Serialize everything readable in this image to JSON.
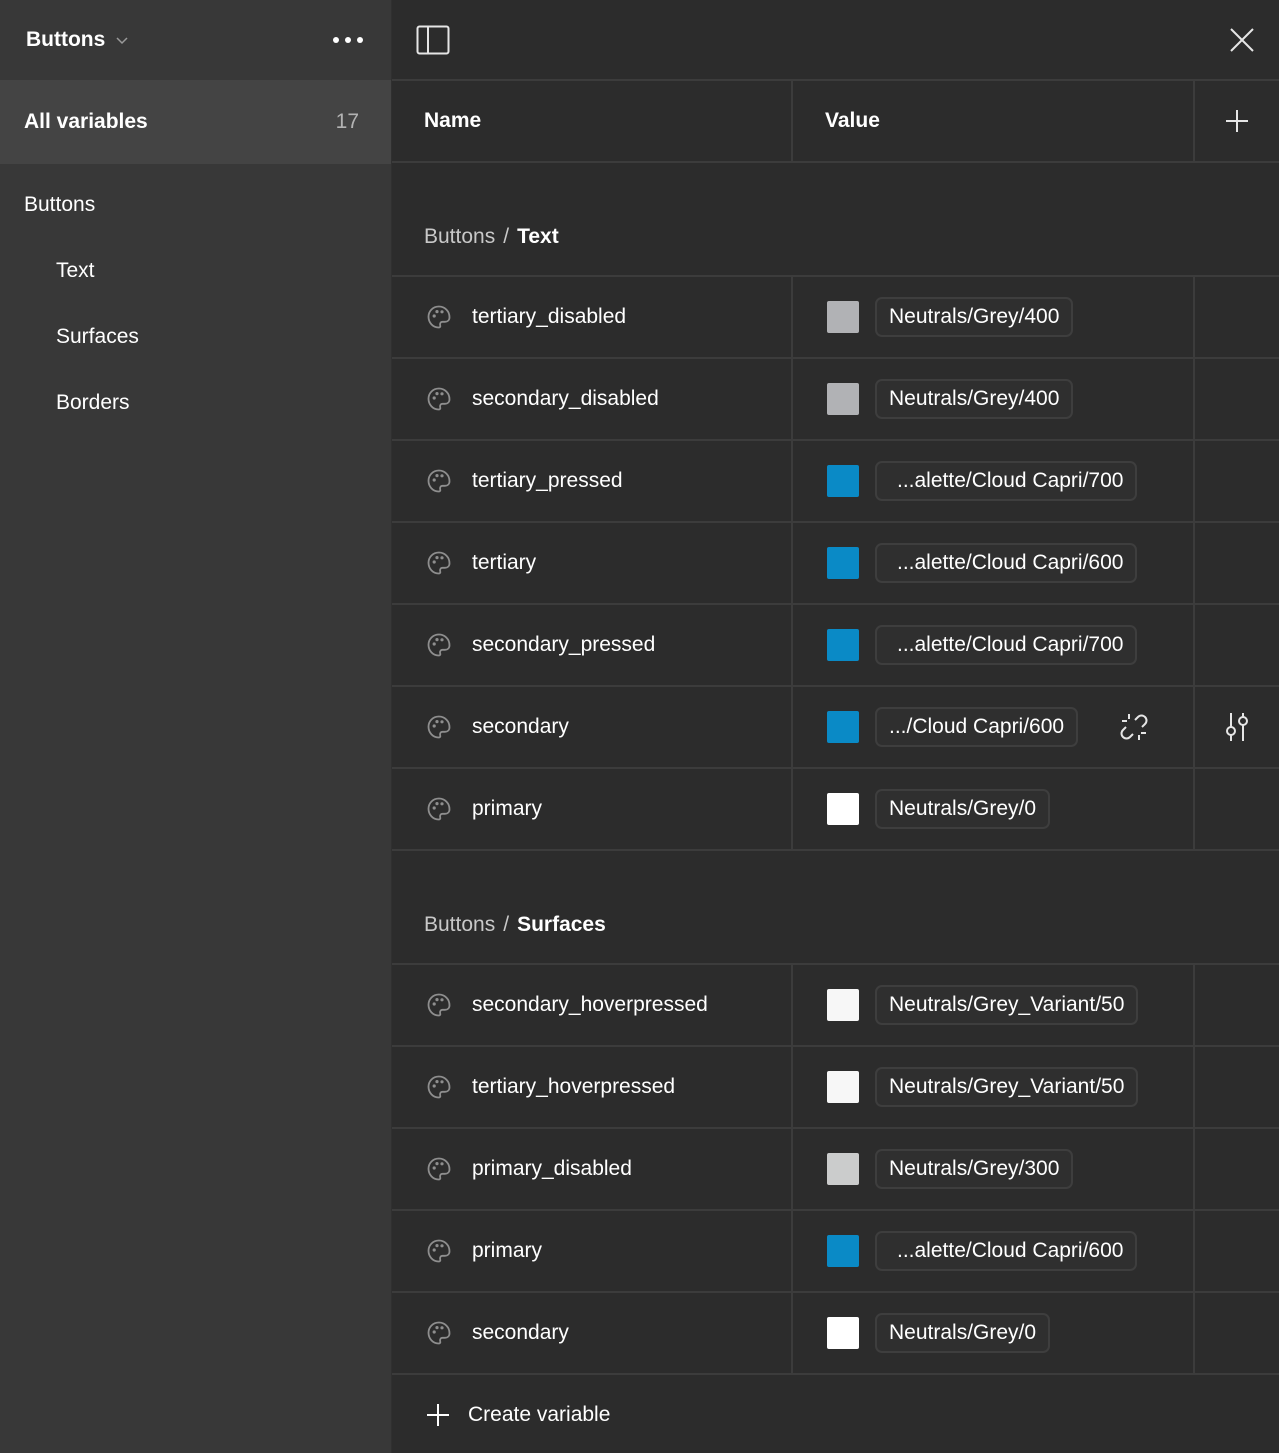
{
  "sidebar": {
    "collection_name": "Buttons",
    "all_variables": {
      "label": "All variables",
      "count": "17"
    },
    "groups": [
      {
        "label": "Buttons",
        "level": 0
      },
      {
        "label": "Text",
        "level": 1
      },
      {
        "label": "Surfaces",
        "level": 1
      },
      {
        "label": "Borders",
        "level": 1
      }
    ]
  },
  "table": {
    "headers": {
      "name": "Name",
      "value": "Value"
    },
    "sections": [
      {
        "parent": "Buttons",
        "separator": "/",
        "group": "Text",
        "rows": [
          {
            "name": "tertiary_disabled",
            "swatch": "#b1b2b5",
            "value": "Neutrals/Grey/400"
          },
          {
            "name": "secondary_disabled",
            "swatch": "#b1b2b5",
            "value": "Neutrals/Grey/400"
          },
          {
            "name": "tertiary_pressed",
            "swatch": "#0a8ac6",
            "value": "...alette/Cloud Capri/700"
          },
          {
            "name": "tertiary",
            "swatch": "#0a8ac6",
            "value": "...alette/Cloud Capri/600"
          },
          {
            "name": "secondary_pressed",
            "swatch": "#0a8ac6",
            "value": "...alette/Cloud Capri/700"
          },
          {
            "name": "secondary",
            "swatch": "#0a8ac6",
            "value": ".../Cloud Capri/600",
            "hovered": true
          },
          {
            "name": "primary",
            "swatch": "#ffffff",
            "value": "Neutrals/Grey/0"
          }
        ]
      },
      {
        "parent": "Buttons",
        "separator": "/",
        "group": "Surfaces",
        "rows": [
          {
            "name": "secondary_hoverpressed",
            "swatch": "#f7f7f7",
            "value": "Neutrals/Grey_Variant/50"
          },
          {
            "name": "tertiary_hoverpressed",
            "swatch": "#f7f7f7",
            "value": "Neutrals/Grey_Variant/50"
          },
          {
            "name": "primary_disabled",
            "swatch": "#cbcccc",
            "value": "Neutrals/Grey/300"
          },
          {
            "name": "primary",
            "swatch": "#0a8ac6",
            "value": "...alette/Cloud Capri/600"
          },
          {
            "name": "secondary",
            "swatch": "#ffffff",
            "value": "Neutrals/Grey/0"
          }
        ]
      }
    ],
    "create_label": "Create variable"
  },
  "icons": {
    "sidebar_toggle": "sidebar-toggle-icon",
    "close": "close-icon",
    "add": "plus-icon",
    "row_type": "palette-icon",
    "detach": "unlink-icon",
    "edit": "sliders-icon"
  }
}
